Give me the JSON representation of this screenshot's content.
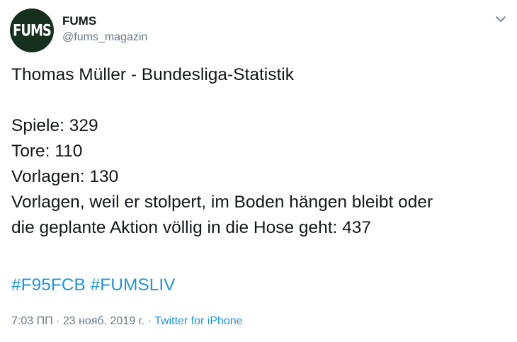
{
  "account": {
    "avatar_text": "FUMS",
    "display_name": "FUMS",
    "handle": "@fums_magazin"
  },
  "tweet": {
    "title_line": "Thomas Müller - Bundesliga-Statistik",
    "stats": [
      "Spiele: 329",
      "Tore: 110",
      "Vorlagen: 130",
      "Vorlagen, weil er stolpert, im Boden hängen bleibt oder",
      "die geplante Aktion völlig in die Hose geht: 437"
    ],
    "hashtags": [
      "#F95FCB",
      "#FUMSLIV"
    ]
  },
  "meta": {
    "time": "7:03 ПП",
    "separator": "·",
    "date": "23 нояб. 2019 г.",
    "source": "Twitter for iPhone"
  },
  "colors": {
    "link": "#1b95e0",
    "secondary_text": "#657786",
    "avatar_bg": "#16301f"
  },
  "icons": {
    "menu": "chevron-down-icon"
  }
}
